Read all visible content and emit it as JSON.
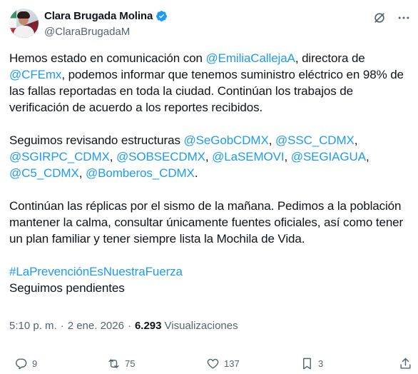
{
  "author": {
    "display_name": "Clara Brugada Molina",
    "handle": "@ClaraBrugadaM",
    "verified_icon": "verified-badge-icon"
  },
  "tweet": {
    "p1": {
      "t1": "Hemos estado en comunicación con ",
      "m1": "@EmiliaCallejaA",
      "t2": ", directora de ",
      "m2": "@CFEmx",
      "t3": ", podemos informar que tenemos suministro eléctrico en 98% de las fallas reportadas en toda la ciudad. Continúan los trabajos de verificación de acuerdo a los reportes recibidos."
    },
    "p2": {
      "t1": "Seguimos revisando estructuras ",
      "mentions": [
        "@SeGobCDMX",
        "@SSC_CDMX",
        "@SGIRPC_CDMX",
        "@SOBSECDMX",
        "@LaSEMOVI",
        "@SEGIAGUA",
        "@C5_CDMX",
        "@Bomberos_CDMX"
      ],
      "end": "."
    },
    "p3": "Continúan las réplicas por el sismo de la mañana. Pedimos a la población mantener la calma, consultar únicamente fuentes oficiales, así como tener un plan familiar y tener siempre lista la Mochila de Vida.",
    "hashtag": "#LaPrevenciónEsNuestraFuerza",
    "closing": "Seguimos pendientes"
  },
  "meta": {
    "time": "5:10 p. m.",
    "separator": "·",
    "date": "2 ene. 2026",
    "views_count": "6.293",
    "views_label": "Visualizaciones"
  },
  "actions": {
    "replies": "9",
    "reposts": "75",
    "likes": "137",
    "bookmarks": "3"
  },
  "colors": {
    "link": "#1d9bf0",
    "text": "#0f1419",
    "secondary": "#536471"
  }
}
